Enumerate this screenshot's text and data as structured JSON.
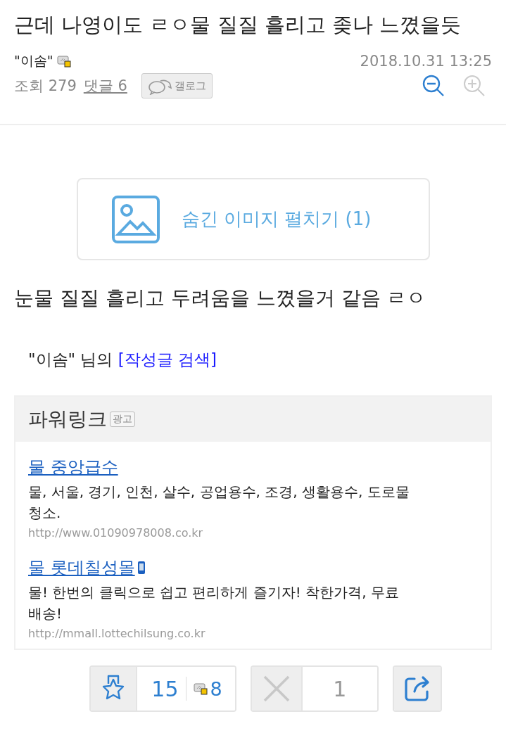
{
  "title": "근데 나영이도 ㄹㅇ물 질질 흘리고 좆나 느꼈을듯",
  "author": {
    "name": "\"이솜\""
  },
  "date": "2018.10.31 13:25",
  "views": "조회 279",
  "comments": "댓글 6",
  "gallog_button": "갤로그",
  "hidden_images": "숨긴 이미지 펼치기 (1)",
  "body": "눈물 질질 흘리고 두려움을 느꼈을거 같음 ㄹㅇ",
  "author_search": {
    "prefix": "\"이솜\" 님의",
    "link": "[작성글 검색]"
  },
  "powerlink": {
    "title": "파워링크",
    "badge": "광고",
    "ads": [
      {
        "title": "물 중앙급수",
        "description": "물, 서울, 경기, 인천, 살수, 공업용수, 조경, 생활용수, 도로물청소.",
        "url": "http://www.01090978008.co.kr",
        "mobile": false
      },
      {
        "title": "물 롯데칠성몰",
        "description": "물! 한번의 클릭으로 쉽고 편리하게 즐기자! 착한가격, 무료배송!",
        "url": "http://mmall.lottechilsung.co.kr",
        "mobile": true
      }
    ]
  },
  "actions": {
    "recommend": "15",
    "fixed_recommend": "8",
    "dislike": "1"
  }
}
